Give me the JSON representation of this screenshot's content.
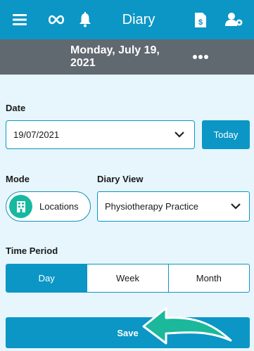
{
  "header": {
    "title": "Diary",
    "icons": [
      "menu-icon",
      "infinity-icon",
      "bell-icon",
      "invoice-icon",
      "user-settings-icon"
    ]
  },
  "date_bar": {
    "current_date": "Monday, July 19, 2021",
    "more_icon": "more-dots-icon"
  },
  "form": {
    "date_label": "Date",
    "date_value": "19/07/2021",
    "today_label": "Today",
    "mode_label": "Mode",
    "mode_value": "Locations",
    "diary_view_label": "Diary View",
    "diary_view_value": "Physiotherapy Practice",
    "time_period_label": "Time Period",
    "time_period_options": [
      "Day",
      "Week",
      "Month"
    ],
    "time_period_selected": "Day",
    "save_label": "Save"
  },
  "colors": {
    "primary": "#0b96c6",
    "date_bar": "#606870",
    "background": "#e6f6fc",
    "mode_knob": "#16b9a0",
    "arrow": "#1bb89b"
  }
}
